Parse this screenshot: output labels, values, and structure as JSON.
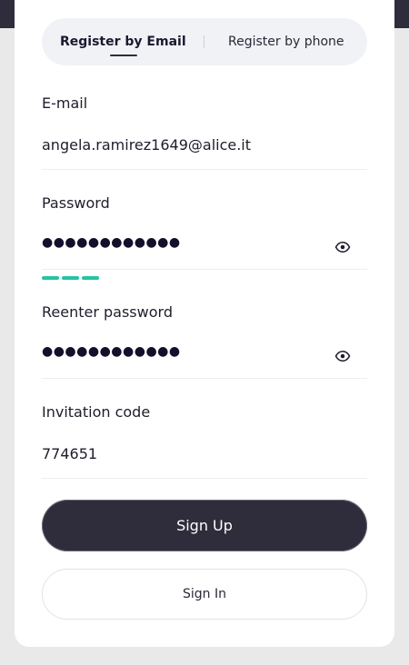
{
  "tabs": {
    "email_label": "Register by Email",
    "phone_label": "Register by phone",
    "active": "email"
  },
  "form": {
    "email": {
      "label": "E-mail",
      "value": "angela.ramirez1649@alice.it"
    },
    "password": {
      "label": "Password",
      "masked": "●●●●●●●●●●●●",
      "strength_segments_filled": 3
    },
    "reenter_password": {
      "label": "Reenter password",
      "masked": "●●●●●●●●●●●●"
    },
    "invitation_code": {
      "label": "Invitation code",
      "value": "774651"
    }
  },
  "actions": {
    "sign_up_label": "Sign Up",
    "sign_in_label": "Sign In"
  },
  "colors": {
    "primary": "#2f2d3b",
    "strength": "#23c4a3",
    "tab_bg": "#f1f2f6"
  },
  "icons": {
    "password_toggle": "eye-icon",
    "reenter_toggle": "eye-icon"
  }
}
